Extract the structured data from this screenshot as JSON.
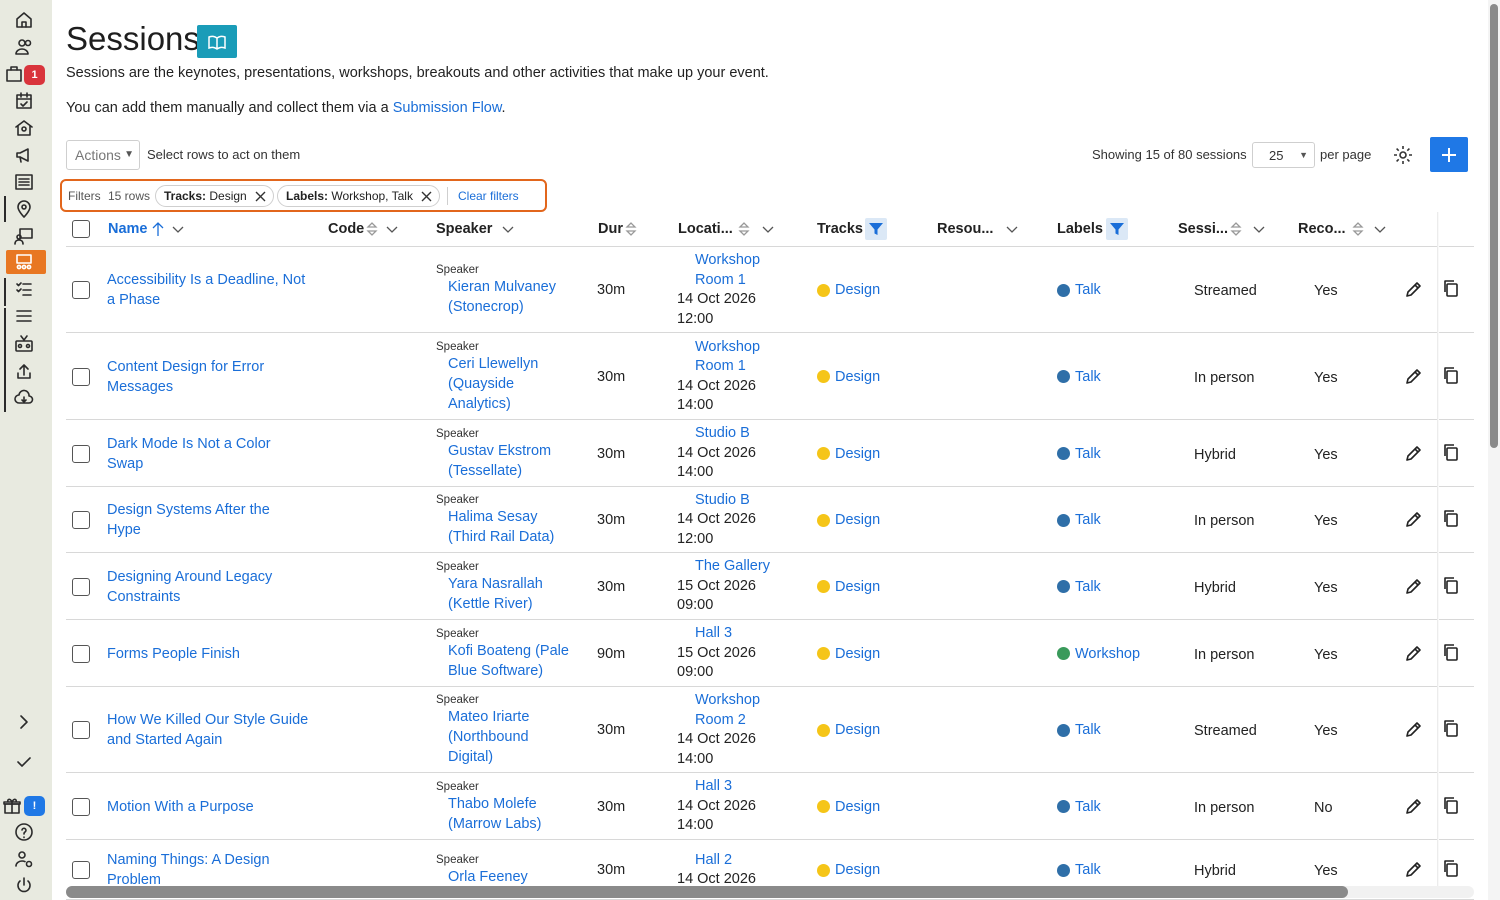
{
  "page": {
    "title": "Sessions",
    "description": "Sessions are the keynotes, presentations, workshops, breakouts and other activities that make up your event.",
    "add_text": "You can add them manually and collect them via a",
    "add_link": "Submission Flow",
    "add_tail": "."
  },
  "sidebar": {
    "badge_count": "1",
    "badge_info": "!",
    "accent_color": "#e87722"
  },
  "toolbar": {
    "actions_label": "Actions",
    "actions_hint": "Select rows to act on them",
    "showing": "Showing 15 of 80 sessions",
    "per_page_value": "25",
    "per_page_label": "per page"
  },
  "filters": {
    "label": "Filters",
    "rows": "15 rows",
    "chips": [
      {
        "key": "Tracks:",
        "value": "Design"
      },
      {
        "key": "Labels:",
        "value": "Workshop, Talk"
      }
    ],
    "clear": "Clear filters"
  },
  "columns": [
    "Name",
    "Code",
    "Speaker",
    "Dur",
    "Locati...",
    "Tracks",
    "Resou...",
    "Labels",
    "Sessi...",
    "Reco..."
  ],
  "speaker_role": "Speaker",
  "rows": [
    {
      "name": [
        "Accessibility Is a Deadline, Not",
        "a Phase"
      ],
      "speaker": [
        "Kieran Mulvaney",
        "(Stonecrop)"
      ],
      "dur": "30m",
      "room": [
        "Workshop",
        "Room 1"
      ],
      "date": "14 Oct 2026",
      "time": "12:00",
      "track": "Design",
      "label": "Talk",
      "label_color": "#2f6fa8",
      "session": "Streamed",
      "recorded": "Yes"
    },
    {
      "name": [
        "Content Design for Error",
        "Messages"
      ],
      "speaker": [
        "Ceri Llewellyn",
        "(Quayside",
        "Analytics)"
      ],
      "dur": "30m",
      "room": [
        "Workshop",
        "Room 1"
      ],
      "date": "14 Oct 2026",
      "time": "14:00",
      "track": "Design",
      "label": "Talk",
      "label_color": "#2f6fa8",
      "session": "In person",
      "recorded": "Yes"
    },
    {
      "name": [
        "Dark Mode Is Not a Color",
        "Swap"
      ],
      "speaker": [
        "Gustav Ekstrom",
        "(Tessellate)"
      ],
      "dur": "30m",
      "room": [
        "Studio B"
      ],
      "date": "14 Oct 2026",
      "time": "14:00",
      "track": "Design",
      "label": "Talk",
      "label_color": "#2f6fa8",
      "session": "Hybrid",
      "recorded": "Yes"
    },
    {
      "name": [
        "Design Systems After the",
        "Hype"
      ],
      "speaker": [
        "Halima Sesay",
        "(Third Rail Data)"
      ],
      "dur": "30m",
      "room": [
        "Studio B"
      ],
      "date": "14 Oct 2026",
      "time": "12:00",
      "track": "Design",
      "label": "Talk",
      "label_color": "#2f6fa8",
      "session": "In person",
      "recorded": "Yes"
    },
    {
      "name": [
        "Designing Around Legacy",
        "Constraints"
      ],
      "speaker": [
        "Yara Nasrallah",
        "(Kettle River)"
      ],
      "dur": "30m",
      "room": [
        "The Gallery"
      ],
      "date": "15 Oct 2026",
      "time": "09:00",
      "track": "Design",
      "label": "Talk",
      "label_color": "#2f6fa8",
      "session": "Hybrid",
      "recorded": "Yes"
    },
    {
      "name": [
        "Forms People Finish"
      ],
      "speaker": [
        "Kofi Boateng (Pale",
        "Blue Software)"
      ],
      "dur": "90m",
      "room": [
        "Hall 3"
      ],
      "date": "15 Oct 2026",
      "time": "09:00",
      "track": "Design",
      "label": "Workshop",
      "label_color": "#3a9a5b",
      "session": "In person",
      "recorded": "Yes"
    },
    {
      "name": [
        "How We Killed Our Style Guide",
        "and Started Again"
      ],
      "speaker": [
        "Mateo Iriarte",
        "(Northbound",
        "Digital)"
      ],
      "dur": "30m",
      "room": [
        "Workshop",
        "Room 2"
      ],
      "date": "14 Oct 2026",
      "time": "14:00",
      "track": "Design",
      "label": "Talk",
      "label_color": "#2f6fa8",
      "session": "Streamed",
      "recorded": "Yes"
    },
    {
      "name": [
        "Motion With a Purpose"
      ],
      "speaker": [
        "Thabo Molefe",
        "(Marrow Labs)"
      ],
      "dur": "30m",
      "room": [
        "Hall 3"
      ],
      "date": "14 Oct 2026",
      "time": "14:00",
      "track": "Design",
      "label": "Talk",
      "label_color": "#2f6fa8",
      "session": "In person",
      "recorded": "No"
    },
    {
      "name": [
        "Naming Things: A Design",
        "Problem"
      ],
      "speaker": [
        "Orla Feeney"
      ],
      "dur": "30m",
      "room": [
        "Hall 2"
      ],
      "date": "14 Oct 2026",
      "time": "",
      "track": "Design",
      "label": "Talk",
      "label_color": "#2f6fa8",
      "session": "Hybrid",
      "recorded": "Yes"
    }
  ],
  "colors": {
    "link": "#1a6ed8",
    "primary": "#1f78e6",
    "teal": "#1a9cb8",
    "track_dot": "#f5c518",
    "filter_outline": "#e2661c"
  }
}
